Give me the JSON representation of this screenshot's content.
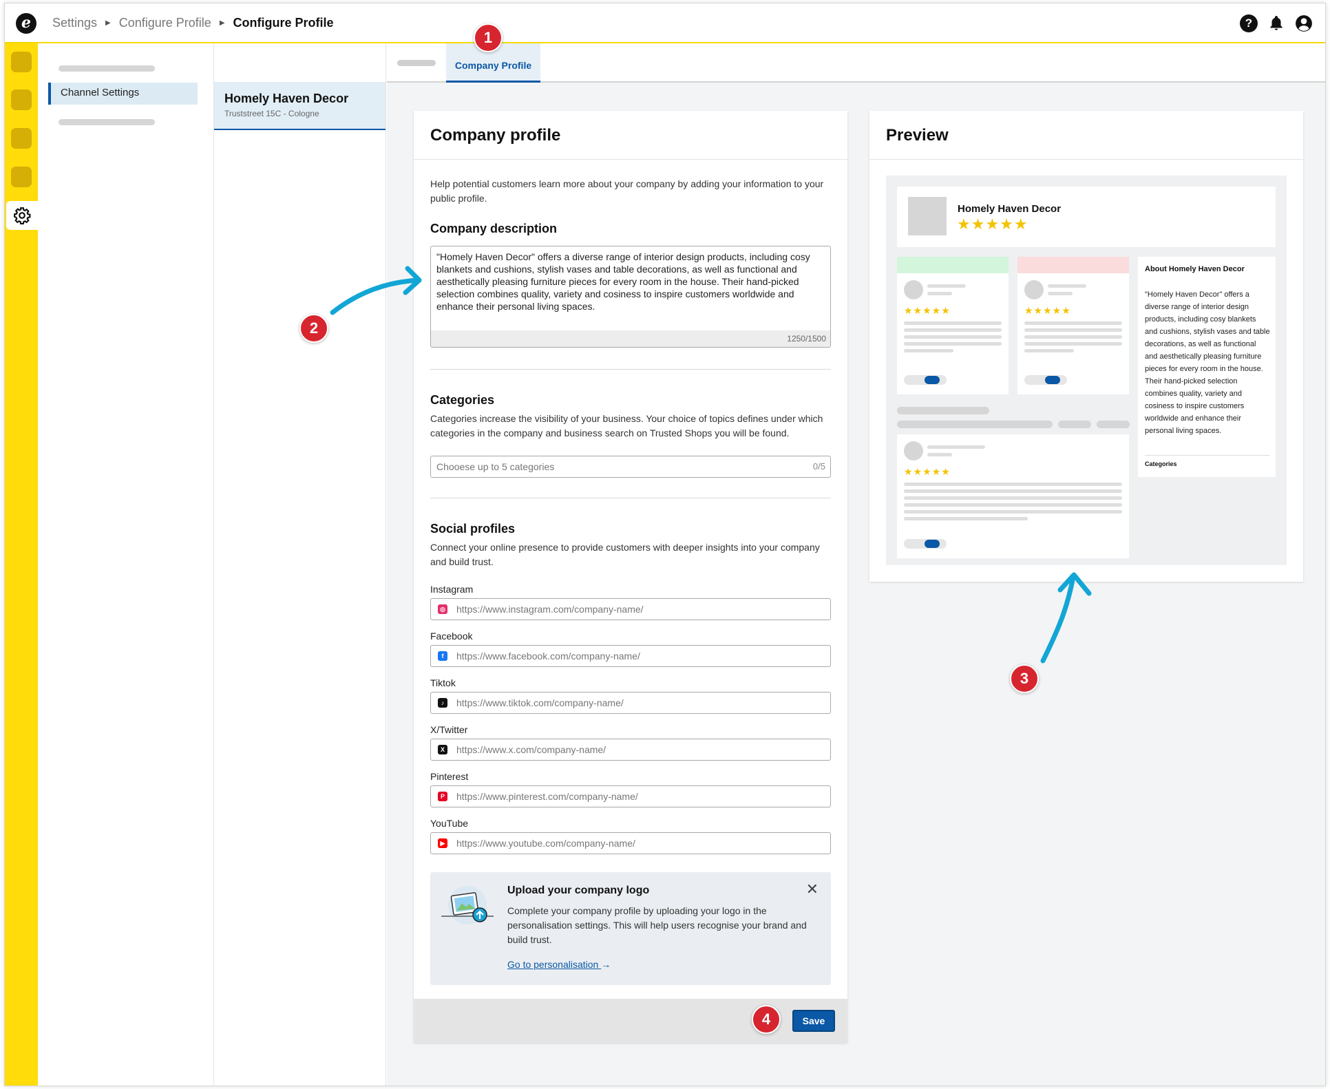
{
  "topbar": {
    "logo_letter": "e",
    "breadcrumbs": [
      "Settings",
      "Configure Profile",
      "Configure Profile"
    ],
    "icons": [
      "help-icon",
      "bell-icon",
      "account-icon"
    ]
  },
  "nav": {
    "channel_settings": "Channel Settings"
  },
  "shop": {
    "name": "Homely Haven Decor",
    "address": "Truststreet 15C - Cologne"
  },
  "tabs": {
    "active": "Company Profile"
  },
  "company_profile": {
    "title": "Company profile",
    "intro": "Help potential customers learn more about your company by adding your information to your public profile.",
    "description_heading": "Company description",
    "description_value": "\"Homely Haven Decor\" offers a diverse range of interior design products, including cosy blankets and cushions, stylish vases and table decorations, as well as functional and aesthetically pleasing furniture pieces for every room in the house. Their hand-picked selection combines quality, variety and cosiness to inspire customers worldwide and enhance their personal living spaces.",
    "description_count": "1250/1500",
    "categories_heading": "Categories",
    "categories_text": "Categories increase the visibility of your business. Your choice of topics defines under which categories in the company and business search on Trusted Shops you will be found.",
    "categories_placeholder": "Chooese up to 5 categories",
    "categories_count": "0/5",
    "social_heading": "Social profiles",
    "social_text": "Connect your online presence to provide customers with deeper insights into your company and build trust.",
    "social": [
      {
        "label": "Instagram",
        "placeholder": "https://www.instagram.com/company-name/",
        "icon": "instagram-icon",
        "color": "#e1306c"
      },
      {
        "label": "Facebook",
        "placeholder": "https://www.facebook.com/company-name/",
        "icon": "facebook-icon",
        "color": "#1877f2"
      },
      {
        "label": "Tiktok",
        "placeholder": "https://www.tiktok.com/company-name/",
        "icon": "tiktok-icon",
        "color": "#111111"
      },
      {
        "label": "X/Twitter",
        "placeholder": "https://www.x.com/company-name/",
        "icon": "x-icon",
        "color": "#111111"
      },
      {
        "label": "Pinterest",
        "placeholder": "https://www.pinterest.com/company-name/",
        "icon": "pinterest-icon",
        "color": "#e60023"
      },
      {
        "label": "YouTube",
        "placeholder": "https://www.youtube.com/company-name/",
        "icon": "youtube-icon",
        "color": "#ff0000"
      }
    ],
    "upload": {
      "title": "Upload your company logo",
      "text": "Complete your company profile by uploading your logo in the personalisation settings. This will help users recognise your brand and build trust.",
      "link": "Go to personalisation"
    },
    "save_label": "Save"
  },
  "preview": {
    "title": "Preview",
    "shop_name": "Homely Haven Decor",
    "stars": "★★★★★",
    "about_title": "About Homely Haven Decor",
    "about_text": "\"Homely Haven Decor\" offers a diverse range of interior design products, including cosy blankets and cushions, stylish vases and table decorations, as well as functional and aesthetically pleasing furniture pieces for every room in the house. Their hand-picked selection combines quality, variety and cosiness to inspire customers worldwide and enhance their personal living spaces.",
    "categories_label": "Categories"
  },
  "annotations": [
    "1",
    "2",
    "3",
    "4"
  ],
  "colors": {
    "accent": "#0a58a6",
    "rail": "#ffdc0a",
    "badge": "#d7252f",
    "arrow": "#12a6d6",
    "star": "#f3c300"
  }
}
